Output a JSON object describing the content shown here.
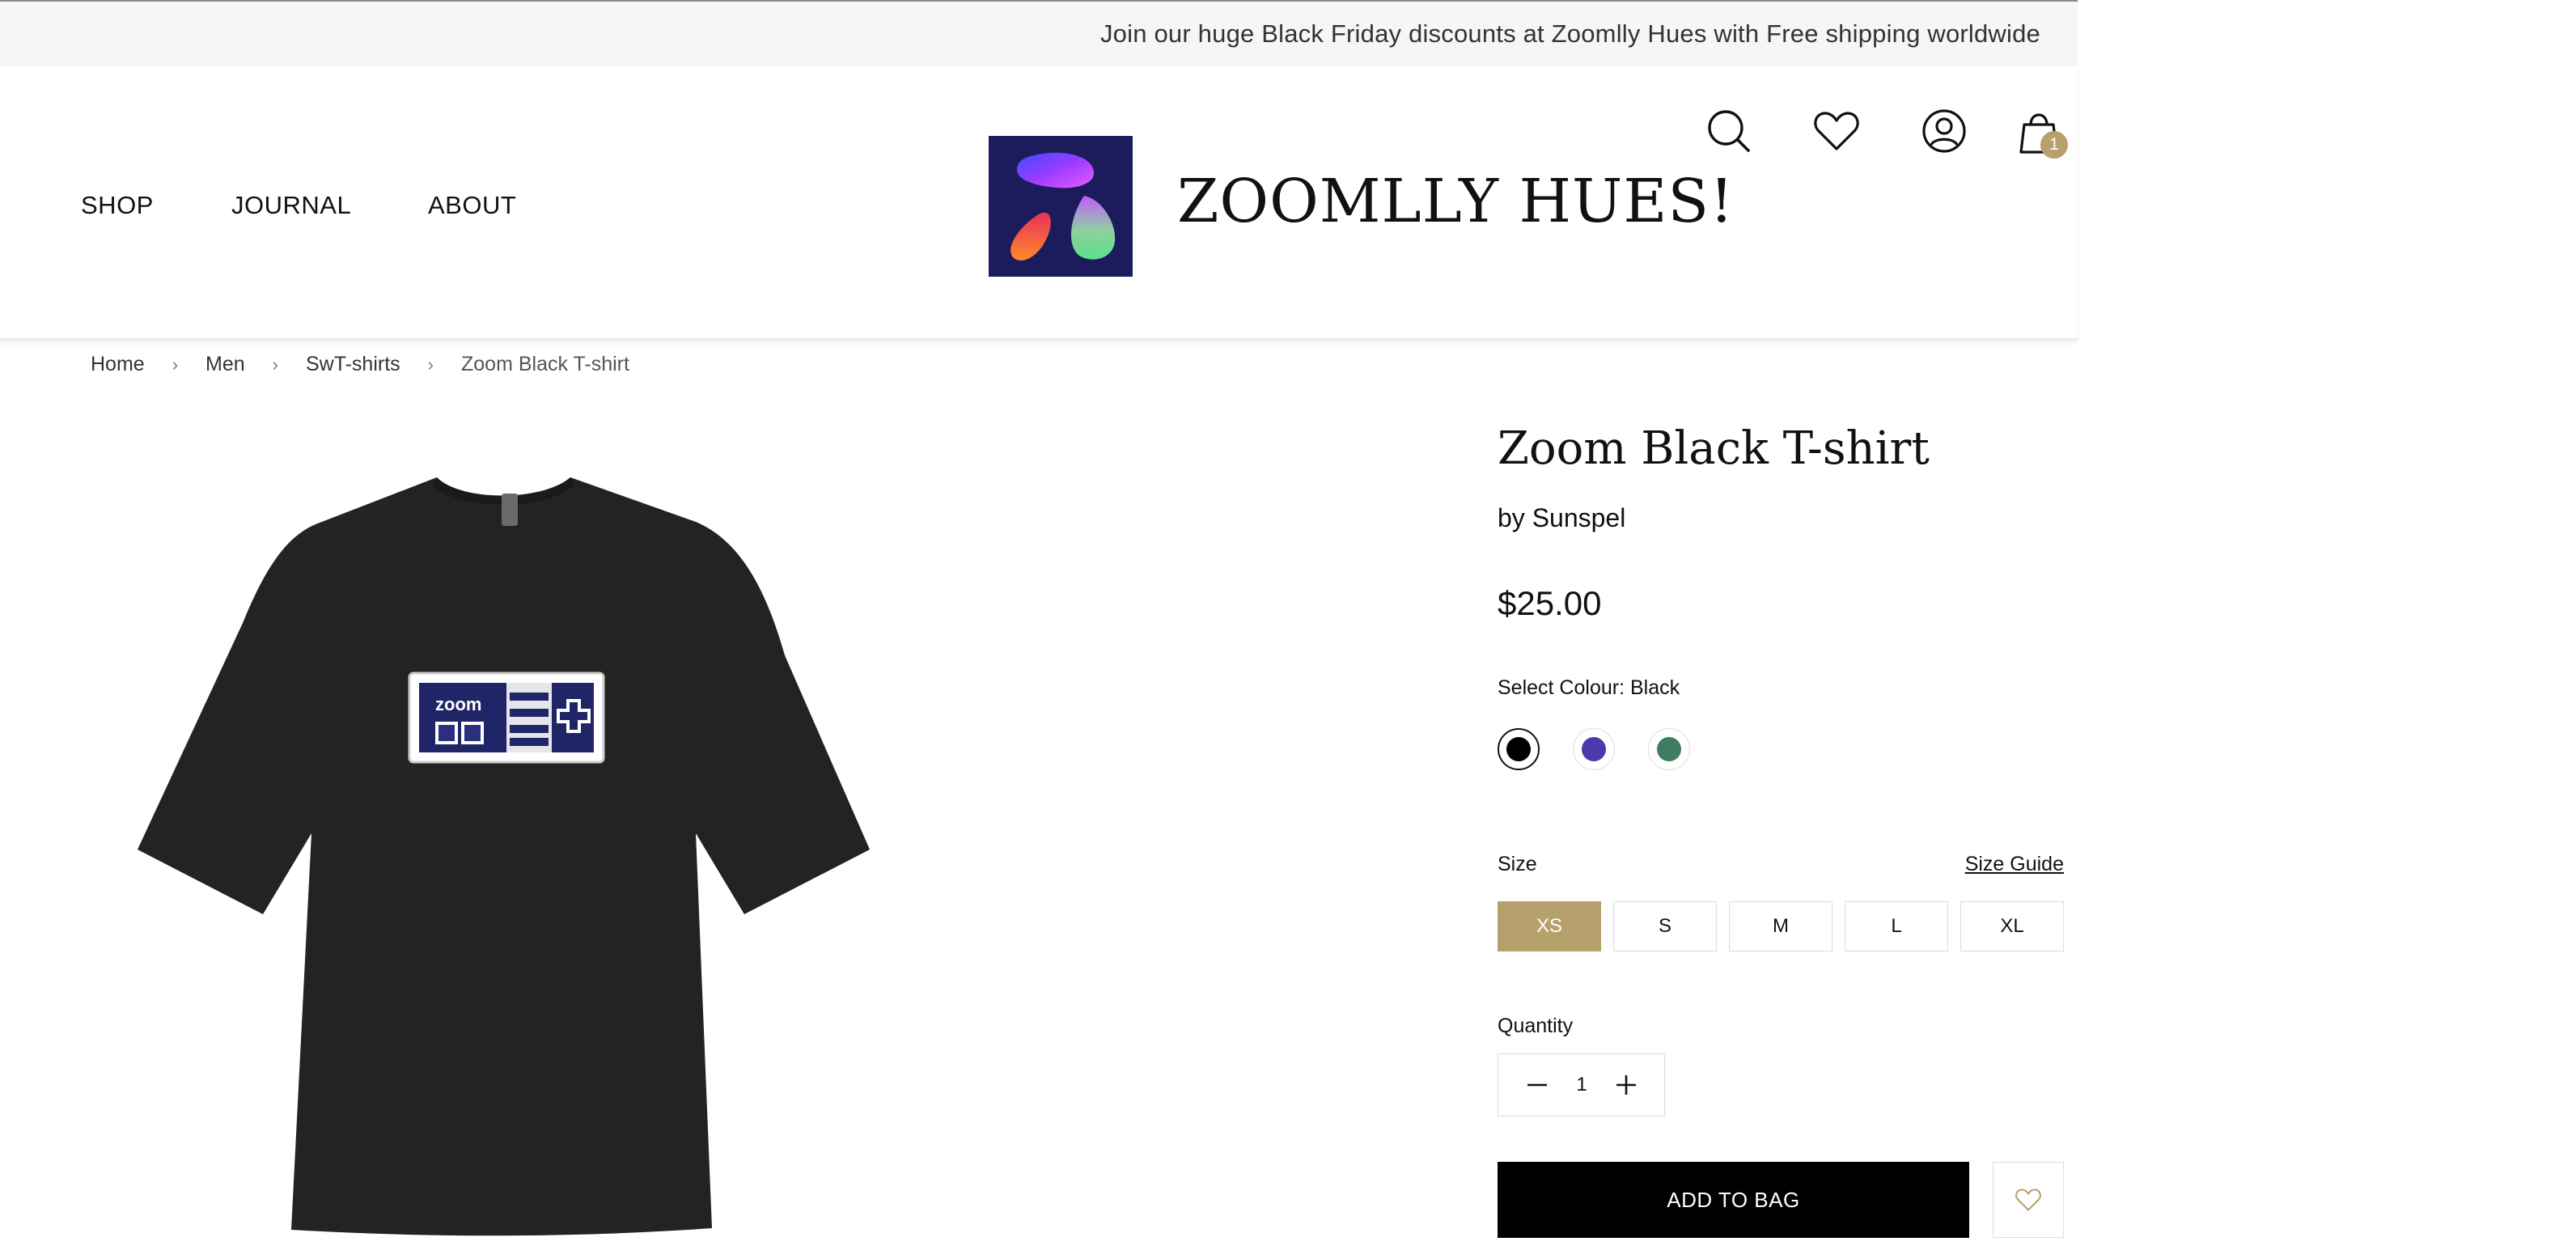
{
  "announcement": {
    "text": "Join our huge Black Friday discounts at Zoomlly Hues with Free shipping worldwide"
  },
  "nav": {
    "items": [
      "SHOP",
      "JOURNAL",
      "ABOUT"
    ]
  },
  "brand": {
    "name": "ZOOMLLY HUES!"
  },
  "header_icons": [
    "search-icon",
    "heart-icon",
    "user-icon",
    "shopping-bag-icon"
  ],
  "cart": {
    "count": "1"
  },
  "breadcrumb": [
    "Home",
    "Men",
    "SwT-shirts",
    "Zoom Black T-shirt"
  ],
  "product": {
    "title": "Zoom Black T-shirt",
    "by": "by Sunspel",
    "price": "$25.00",
    "image_print_text": "zoom"
  },
  "colour": {
    "label": "Select Colour: Black",
    "swatches": [
      {
        "name": "black",
        "hex": "#000000",
        "selected": true
      },
      {
        "name": "purple",
        "hex": "#4a3aae",
        "selected": false
      },
      {
        "name": "green",
        "hex": "#3f7c62",
        "selected": false
      }
    ]
  },
  "size": {
    "label": "Size",
    "guide": "Size Guide",
    "options": [
      "XS",
      "S",
      "M",
      "L",
      "XL"
    ],
    "selected": "XS"
  },
  "quantity": {
    "label": "Quantity",
    "value": "1"
  },
  "actions": {
    "add_to_bag": "ADD TO BAG"
  },
  "colors": {
    "accent": "#b6a06c",
    "announce_bg": "#f6f6f6",
    "logo_bg": "#1c1b5b"
  }
}
